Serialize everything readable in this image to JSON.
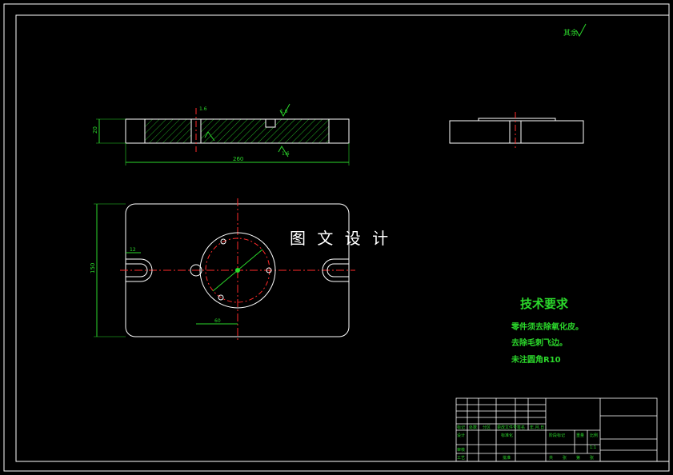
{
  "watermark": "图 文 设 计",
  "surface_roughness_note": "其余",
  "technical_requirements": {
    "title": "技术要求",
    "lines": [
      "零件须去除氧化皮。",
      "去除毛刺飞边。",
      "未注圆角R10"
    ]
  },
  "dimensions": {
    "front_height": "20",
    "front_length": "260",
    "top_height": "150",
    "slot_width": "12",
    "offset": "60",
    "ra_a": "1.6",
    "ra_b": "1.6",
    "ra_c": "1.6"
  },
  "title_block": {
    "c1": "标记",
    "c2": "处数",
    "c3": "分区",
    "c4": "更改文件号",
    "c5": "签名",
    "c6": "年.月.日",
    "d1": "设计",
    "d2": "标准化",
    "d3": "阶段标记",
    "d4": "重量",
    "d5": "比例",
    "e1": "审核",
    "e2": "工艺",
    "e3": "批准",
    "scale": "1:1",
    "sheets": [
      "共",
      "张",
      "第",
      "张"
    ]
  },
  "colors": {
    "background": "#000000",
    "border": "#ffffff",
    "outline": "#ffffff",
    "dimension": "#2bd82b",
    "centerline": "#ff2a2a",
    "hatch": "#2bd82b"
  }
}
